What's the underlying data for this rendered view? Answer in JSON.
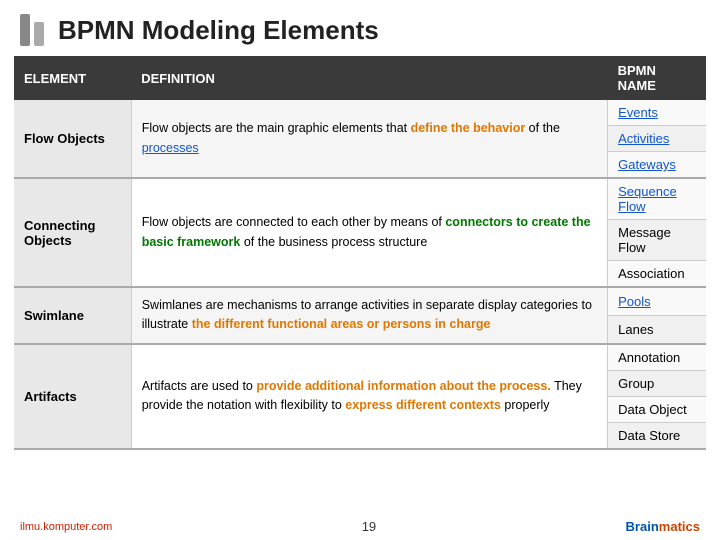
{
  "header": {
    "title": "BPMN Modeling Elements",
    "icon_bars": [
      "bar1",
      "bar2"
    ]
  },
  "table": {
    "columns": [
      "ELEMENT",
      "DEFINITION",
      "BPMN NAME"
    ],
    "rows": [
      {
        "element": "Flow Objects",
        "definition_parts": [
          {
            "text": "Flow objects are the main graphic elements that "
          },
          {
            "text": "define the behavior",
            "class": "highlight-orange"
          },
          {
            "text": " of the "
          },
          {
            "text": "processes",
            "class": "link-style"
          }
        ],
        "bpmn_names": [
          "Events",
          "Activities",
          "Gateways"
        ],
        "bpmn_classes": [
          "link-style",
          "link-style",
          "link-style"
        ]
      },
      {
        "element": "Connecting Objects",
        "definition_parts": [
          {
            "text": "Flow objects are connected to each other by means of "
          },
          {
            "text": "connectors to create the basic framework",
            "class": "highlight-green"
          },
          {
            "text": " of the business process structure"
          }
        ],
        "bpmn_names": [
          "Sequence Flow",
          "Message Flow",
          "Association"
        ],
        "bpmn_classes": [
          "link-style",
          "",
          ""
        ]
      },
      {
        "element": "Swimlane",
        "definition_parts": [
          {
            "text": "Swimlanes are mechanisms to arrange activities in separate display categories to illustrate "
          },
          {
            "text": "the different functional areas or persons in charge",
            "class": "highlight-orange"
          }
        ],
        "bpmn_names": [
          "Pools",
          "Lanes"
        ],
        "bpmn_classes": [
          "link-style",
          ""
        ]
      },
      {
        "element": "Artifacts",
        "definition_parts": [
          {
            "text": "Artifacts are used to "
          },
          {
            "text": "provide additional information about the process.",
            "class": "highlight-orange"
          },
          {
            "text": " They provide the notation with flexibility to "
          },
          {
            "text": "express different contexts",
            "class": "highlight-orange"
          },
          {
            "text": " properly"
          }
        ],
        "bpmn_names": [
          "Annotation",
          "Group",
          "Data Object",
          "Data Store"
        ],
        "bpmn_classes": [
          "",
          "",
          "",
          ""
        ]
      }
    ]
  },
  "footer": {
    "left_text": "ilmu.komputer.com",
    "page_number": "19",
    "logo_brain": "Brain",
    "logo_matics": "matics"
  }
}
